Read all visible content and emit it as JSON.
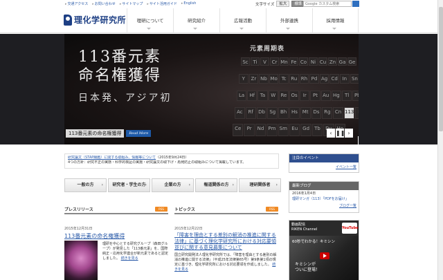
{
  "utility": [
    "交通アクセス",
    "お問い合わせ",
    "サイトマップ",
    "サイト活用ガイド",
    "English"
  ],
  "text_size": {
    "label": "文字サイズ",
    "large": "拡大",
    "standard": "標準"
  },
  "search": {
    "placeholder": "Google カスタム検索"
  },
  "logo": {
    "text": "理化学研究所"
  },
  "nav": [
    "理研について",
    "研究紹介",
    "広報活動",
    "外部連携",
    "採用情報"
  ],
  "hero": {
    "title_line1": "113番元素",
    "title_line2": "命名権獲得",
    "subtitle": "日本発、アジア初",
    "table_title": "元素周期表",
    "caption": "113番元素の命名権獲得",
    "read_more": "Read More",
    "controls": [
      "‹",
      "❚❚",
      "›"
    ],
    "cells": [
      "Sc",
      "Ti",
      "V",
      "Cr",
      "Mn",
      "Fe",
      "Co",
      "Ni",
      "Cu",
      "Zn",
      "Ga",
      "Ge",
      "Y",
      "Zr",
      "Nb",
      "Mo",
      "Tc",
      "Ru",
      "Rh",
      "Pd",
      "Ag",
      "Cd",
      "In",
      "Sn",
      "La",
      "Hf",
      "Ta",
      "W",
      "Re",
      "Os",
      "Ir",
      "Pt",
      "Au",
      "Hg",
      "Tl",
      "Pb",
      "Ac",
      "Rf",
      "Db",
      "Sg",
      "Bh",
      "Hs",
      "Mt",
      "Ds",
      "Rg",
      "Cn",
      "113",
      "Fl",
      "Ce",
      "Pr",
      "Nd",
      "Pm",
      "Sm",
      "Eu",
      "Gd",
      "Tb",
      "Dy",
      "Ho"
    ]
  },
  "notice": {
    "link": "研究論文（STAP細胞）に関する取組み、情報等について",
    "date": "（2015年9月24日）",
    "line2": "4つの方針：研究不正の実態・科学的検証の実施・研究論文の取下げ・再発防止の取組みについて掲載しています。"
  },
  "audience": [
    "一般の方",
    "研究者・学生の方",
    "企業の方",
    "報道関係の方",
    "理研関係者"
  ],
  "press": {
    "heading": "プレスリリース",
    "rss": "RSS",
    "date": "2015年12月31日",
    "headline": "113番元素の命名権獲得",
    "body": "理研を中心とする研究グループ（森田グループ）が発見した「113番元素」を、国際純正・応用化学連合が新元素であると認定しました。",
    "more": "続きを見る"
  },
  "topics": {
    "heading": "トピックス",
    "rss": "RSS",
    "date": "2015年12月22日",
    "headline": "「障害を理由とする差別の解消の推進に関する法律」に基づく理化学研究所における対応要領並びに関する意見募集について",
    "body": "国立研究開発法人理化学研究所では、「障害を理由とする差別の解消の推進に関する法律」（平成25年法律第65号）第9条第1項の規定に基づき、理化学研究所における対応要領を作成しました。",
    "more": "続きを見る"
  },
  "events": {
    "heading": "注目のイベント",
    "link": "イベント一覧"
  },
  "blog": {
    "heading": "最新ブログ",
    "date": "2016年1月4日",
    "entry": "理研マンガ（113）「PDFをお届け」",
    "link": "ブログ一覧"
  },
  "video": {
    "label_line1": "動画配信",
    "label_line2": "RIKEN Channel",
    "logo": "YouTube",
    "title": "60秒でわかる！キミシン",
    "caption_line1": "キミシンが",
    "caption_line2": "ついに登場！"
  }
}
